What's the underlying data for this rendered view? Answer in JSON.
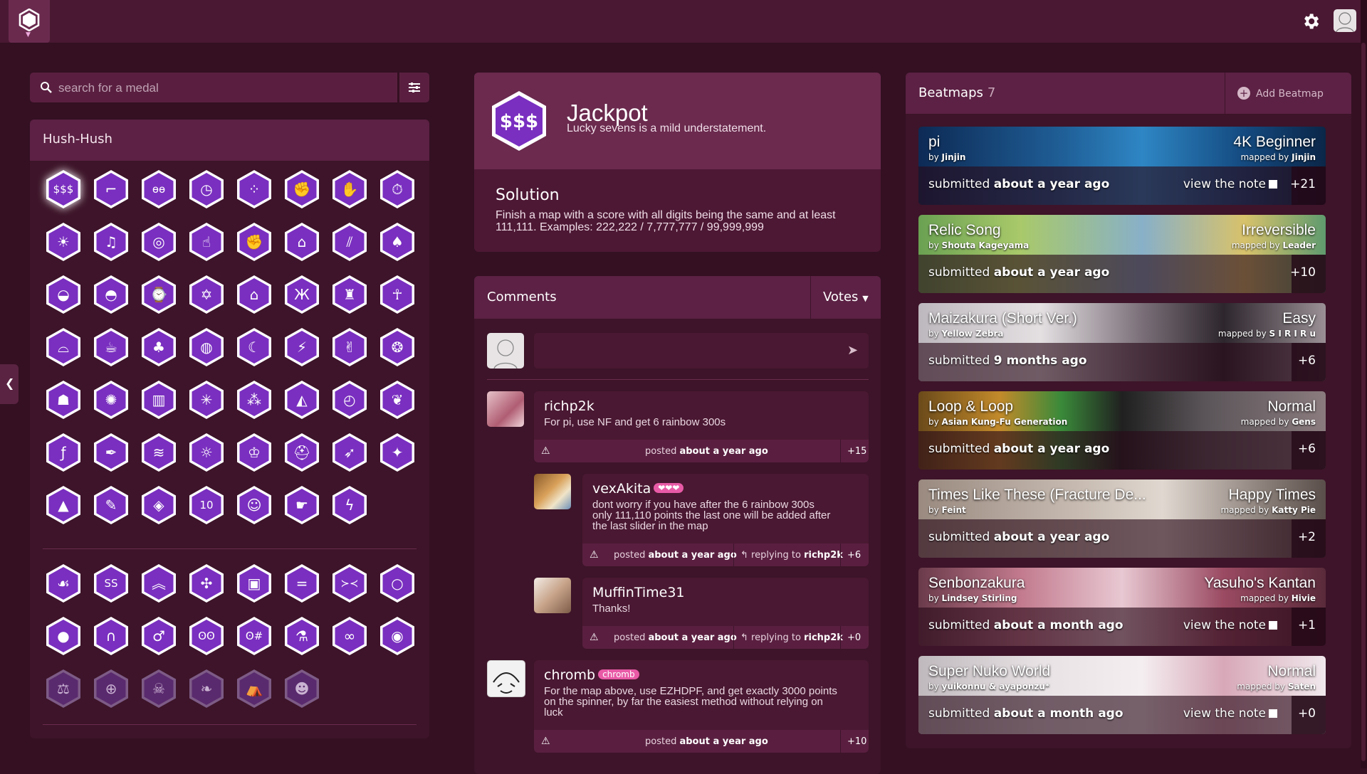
{
  "colors": {
    "background": "#341022",
    "topbar": "#4a1832",
    "panel": "#3d1429",
    "panel_head": "#5c2144",
    "medal": "#7a2fc0",
    "medal_ring": "#ffffff",
    "tag": "#e85aa6"
  },
  "search": {
    "placeholder": "search for a medal"
  },
  "group": {
    "title": "Hush-Hush"
  },
  "medal_icons_group1": [
    "dollar",
    "gun",
    "eyes",
    "clock",
    "dots",
    "fist",
    "flame-hand",
    "stopwatch",
    "sun",
    "headphones",
    "target",
    "hand-flame",
    "raised-fist",
    "mask",
    "slashes",
    "mushroom",
    "sunrise",
    "turtle",
    "watch",
    "pentagram",
    "house",
    "butterfly",
    "top-hat",
    "dancer",
    "sunglasses",
    "cup",
    "tree",
    "rings",
    "moon",
    "runner",
    "rock-hand",
    "bubbles",
    "ghost",
    "bug",
    "skyscraper",
    "burst",
    "sparkles",
    "shapes",
    "clock-face",
    "leaf",
    "function",
    "feather",
    "wave",
    "bulb",
    "crown",
    "helmet",
    "rocket",
    "d20",
    "triforce",
    "pen",
    "cube",
    "ten",
    "okay-hand",
    "thumbs-up",
    "lightning"
  ],
  "medal_icons_group2": [
    "rabbit",
    "sss",
    "chevrons",
    "arrows-in",
    "mug",
    "equals",
    "angry-face",
    "ring",
    "circle",
    "arch",
    "male",
    "o-o",
    "o-o-hash",
    "flask",
    "glasses",
    "target-ring",
    "scales",
    "crosshair",
    "skull",
    "wings",
    "tent",
    "face"
  ],
  "medal": {
    "icon_text": "$$$",
    "name": "Jackpot",
    "description": "Lucky sevens is a mild understatement.",
    "solution_title": "Solution",
    "solution_text": "Finish a map with a score with all digits being the same and at least 111,111. Examples: 222,222 / 7,777,777 / 99,999,999"
  },
  "comments": {
    "title": "Comments",
    "sort": "Votes",
    "items": [
      {
        "user": "richp2k",
        "tag": "",
        "text": [
          "For pi, use NF and get 6 rainbow 300s"
        ],
        "posted_prefix": "posted",
        "posted": "about a year ago",
        "reply_to": "",
        "votes": "+15"
      },
      {
        "user": "vexAkita",
        "tag": "❤❤❤",
        "text": [
          "dont worry if you have after the 6 rainbow 300s",
          "only 111,110 points the last one will be added after",
          "the last slider in the map"
        ],
        "posted_prefix": "posted",
        "posted": "about a year ago",
        "reply_prefix": "replying to",
        "reply_to": "richp2k",
        "votes": "+6"
      },
      {
        "user": "MuffinTime31",
        "tag": "",
        "text": [
          "Thanks!"
        ],
        "posted_prefix": "posted",
        "posted": "about a year ago",
        "reply_prefix": "replying to",
        "reply_to": "richp2k",
        "votes": "+0"
      },
      {
        "user": "chromb",
        "tag": "chromb",
        "text": [
          "For the map above, use EZHDPF, and get exactly 3000 points",
          "on the spinner, by far the easiest method without relying on",
          "luck"
        ],
        "posted_prefix": "posted",
        "posted": "about a year ago",
        "reply_to": "",
        "votes": "+10"
      }
    ]
  },
  "beatmaps": {
    "title": "Beatmaps",
    "count": "7",
    "add_label": "Add Beatmap",
    "items": [
      {
        "song": "pi",
        "by": "by",
        "artist": "Jinjin",
        "diff": "4K Beginner",
        "mapped": "mapped by",
        "mapper": "Jinjin",
        "submitted": "submitted",
        "when": "about a year ago",
        "note": "view the note",
        "votes": "+21",
        "bg": "linear-gradient(90deg,#0d2a55 0%,#1f5e96 35%,#2e86c4 55%,#144a80 80%,#0b2648 100%)"
      },
      {
        "song": "Relic Song",
        "by": "by",
        "artist": "Shouta Kageyama",
        "diff": "Irreversible",
        "mapped": "mapped by",
        "mapper": "Leader",
        "submitted": "submitted",
        "when": "about a year ago",
        "note": "",
        "votes": "+10",
        "bg": "linear-gradient(90deg,#6aa152 0%,#a9c96a 25%,#88b0c8 55%,#d8c26b 80%,#5f9a6e 100%)"
      },
      {
        "song": "Maizakura (Short Ver.)",
        "by": "by",
        "artist": "Yellow Zebra",
        "diff": "Easy",
        "mapped": "mapped by",
        "mapper": "S I R I R u",
        "submitted": "submitted",
        "when": "9 months ago",
        "note": "",
        "votes": "+6",
        "bg": "linear-gradient(90deg,#bdb8bd 0%,#e4e0e2 30%,#7a6f78 55%,#2d262c 75%,#9a9096 100%)"
      },
      {
        "song": "Loop & Loop",
        "by": "by",
        "artist": "Asian Kung-Fu Generation",
        "diff": "Normal",
        "mapped": "mapped by",
        "mapper": "Gens",
        "submitted": "submitted",
        "when": "about a year ago",
        "note": "",
        "votes": "+6",
        "bg": "linear-gradient(90deg,#6b4a1a 0%,#c28a2a 20%,#3a8a3a 35%,#202020 50%,#5a5458 70%,#8a7b7e 100%)"
      },
      {
        "song": "Times Like These (Fracture De...",
        "by": "by",
        "artist": "Feint",
        "diff": "Happy Times",
        "mapped": "mapped by",
        "mapper": "Katty Pie",
        "submitted": "submitted",
        "when": "about a year ago",
        "note": "",
        "votes": "+2",
        "bg": "linear-gradient(90deg,#9a8a80 0%,#c8bcb2 40%,#e0d8d0 60%,#8b7f79 85%,#5a4e4a 100%)"
      },
      {
        "song": "Senbonzakura",
        "by": "by",
        "artist": "Lindsey Stirling",
        "diff": "Yasuho's Kantan",
        "mapped": "mapped by",
        "mapper": "Hivie",
        "submitted": "submitted",
        "when": "about a month ago",
        "note": "view the note",
        "votes": "+1",
        "bg": "linear-gradient(90deg,#6a3a4a 0%,#c27a8e 25%,#e8c8d2 50%,#9a4a62 75%,#5a2a3a 100%)"
      },
      {
        "song": "Super Nuko World",
        "by": "by",
        "artist": "yuikonnu & ayaponzu*",
        "diff": "Normal",
        "mapped": "mapped by",
        "mapper": "Saten",
        "submitted": "submitted",
        "when": "about a month ago",
        "note": "view the note",
        "votes": "+0",
        "bg": "linear-gradient(90deg,#bfb8bc 0%,#e8e2e5 30%,#f4eef0 55%,#d8a8b8 75%,#f0e8ec 100%)"
      }
    ]
  }
}
